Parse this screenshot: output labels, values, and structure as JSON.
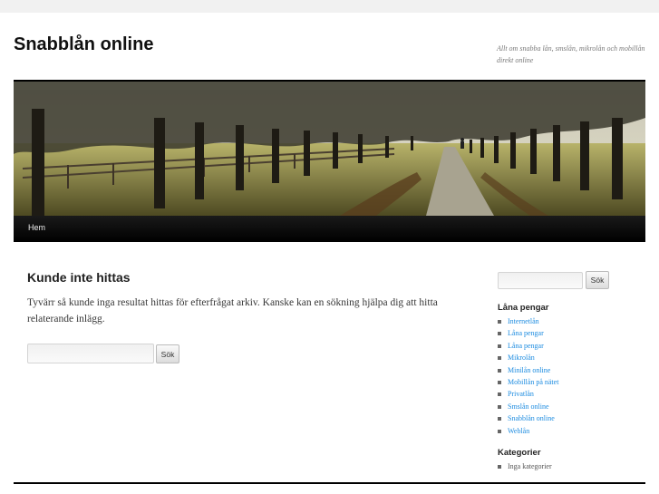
{
  "site": {
    "title": "Snabblån online",
    "description": "Allt om snabba lån, smslån, mikrolån och mobillån direkt online"
  },
  "nav": {
    "items": [
      "Hem"
    ]
  },
  "main": {
    "title": "Kunde inte hittas",
    "text": "Tyvärr så kunde inga resultat hittas för efterfrågat arkiv. Kanske kan en sökning hjälpa dig att hitta relaterande inlägg.",
    "search": {
      "value": "",
      "button_label": "Sök"
    }
  },
  "sidebar": {
    "search": {
      "value": "",
      "button_label": "Sök"
    },
    "widgets": [
      {
        "title": "Låna pengar",
        "items": [
          "Internetlån",
          "Låna pengar",
          "Låna pengar",
          "Mikrolån",
          "Minilån online",
          "Mobillån på nätet",
          "Privatlån",
          "Smslån online",
          "Snabblån online",
          "Weblån"
        ]
      },
      {
        "title": "Kategorier",
        "items": [
          "Inga kategorier"
        ]
      }
    ]
  },
  "colors": {
    "link": "#1b8be0",
    "nav_bg": "#000000",
    "page_bg": "#f1f1f1"
  }
}
